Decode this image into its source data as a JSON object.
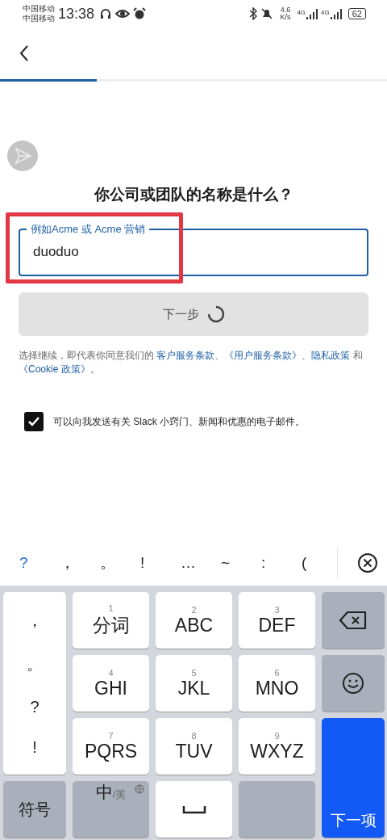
{
  "status_bar": {
    "carriers": [
      "中国移动",
      "中国移动"
    ],
    "time": "13:38",
    "speed": [
      "4.6",
      "K/s"
    ],
    "networks": [
      "4G",
      "4G"
    ],
    "battery": "62"
  },
  "progress": {
    "level": 0.25
  },
  "title": "你公司或团队的名称是什么？",
  "name_field": {
    "label": "例如Acme 或 Acme 营销",
    "value": "duoduo"
  },
  "next_button": {
    "label": "下一步",
    "loading": true
  },
  "terms": [
    {
      "kind": "plain",
      "text": "选择继续，即代表你同意我们的 "
    },
    {
      "kind": "link",
      "text": "客户服务条款"
    },
    {
      "kind": "plain",
      "text": "、"
    },
    {
      "kind": "link",
      "text": "《用户服务条款》"
    },
    {
      "kind": "plain",
      "text": "、"
    },
    {
      "kind": "link",
      "text": "隐私政策"
    },
    {
      "kind": "plain",
      "text": " 和 "
    },
    {
      "kind": "link",
      "text": "《Cookie 政策》"
    },
    {
      "kind": "plain",
      "text": "。"
    }
  ],
  "email_opt_in": {
    "label": "可以向我发送有关 Slack 小窍门、新闻和优惠的电子邮件。",
    "checked": true
  },
  "keyboard": {
    "suggestions": [
      {
        "text": "?",
        "selected": true
      },
      {
        "text": "，",
        "selected": false
      },
      {
        "text": "。",
        "selected": false
      },
      {
        "text": "!",
        "selected": false
      },
      {
        "text": "…",
        "selected": false
      },
      {
        "text": "~",
        "selected": false
      },
      {
        "text": ":",
        "selected": false
      },
      {
        "text": "(",
        "selected": false
      }
    ],
    "punctuation": [
      "，",
      "。",
      "?",
      "!"
    ],
    "keys": [
      {
        "digit": "1",
        "label": "分词"
      },
      {
        "digit": "2",
        "label": "ABC"
      },
      {
        "digit": "3",
        "label": "DEF"
      },
      {
        "digit": "4",
        "label": "GHI"
      },
      {
        "digit": "5",
        "label": "JKL"
      },
      {
        "digit": "6",
        "label": "MNO"
      },
      {
        "digit": "7",
        "label": "PQRS"
      },
      {
        "digit": "8",
        "label": "TUV"
      },
      {
        "digit": "9",
        "label": "WXYZ"
      }
    ],
    "symbols_key": "符号",
    "language_key": {
      "main": "中",
      "sub": "/英"
    },
    "action_key": "下一项"
  }
}
